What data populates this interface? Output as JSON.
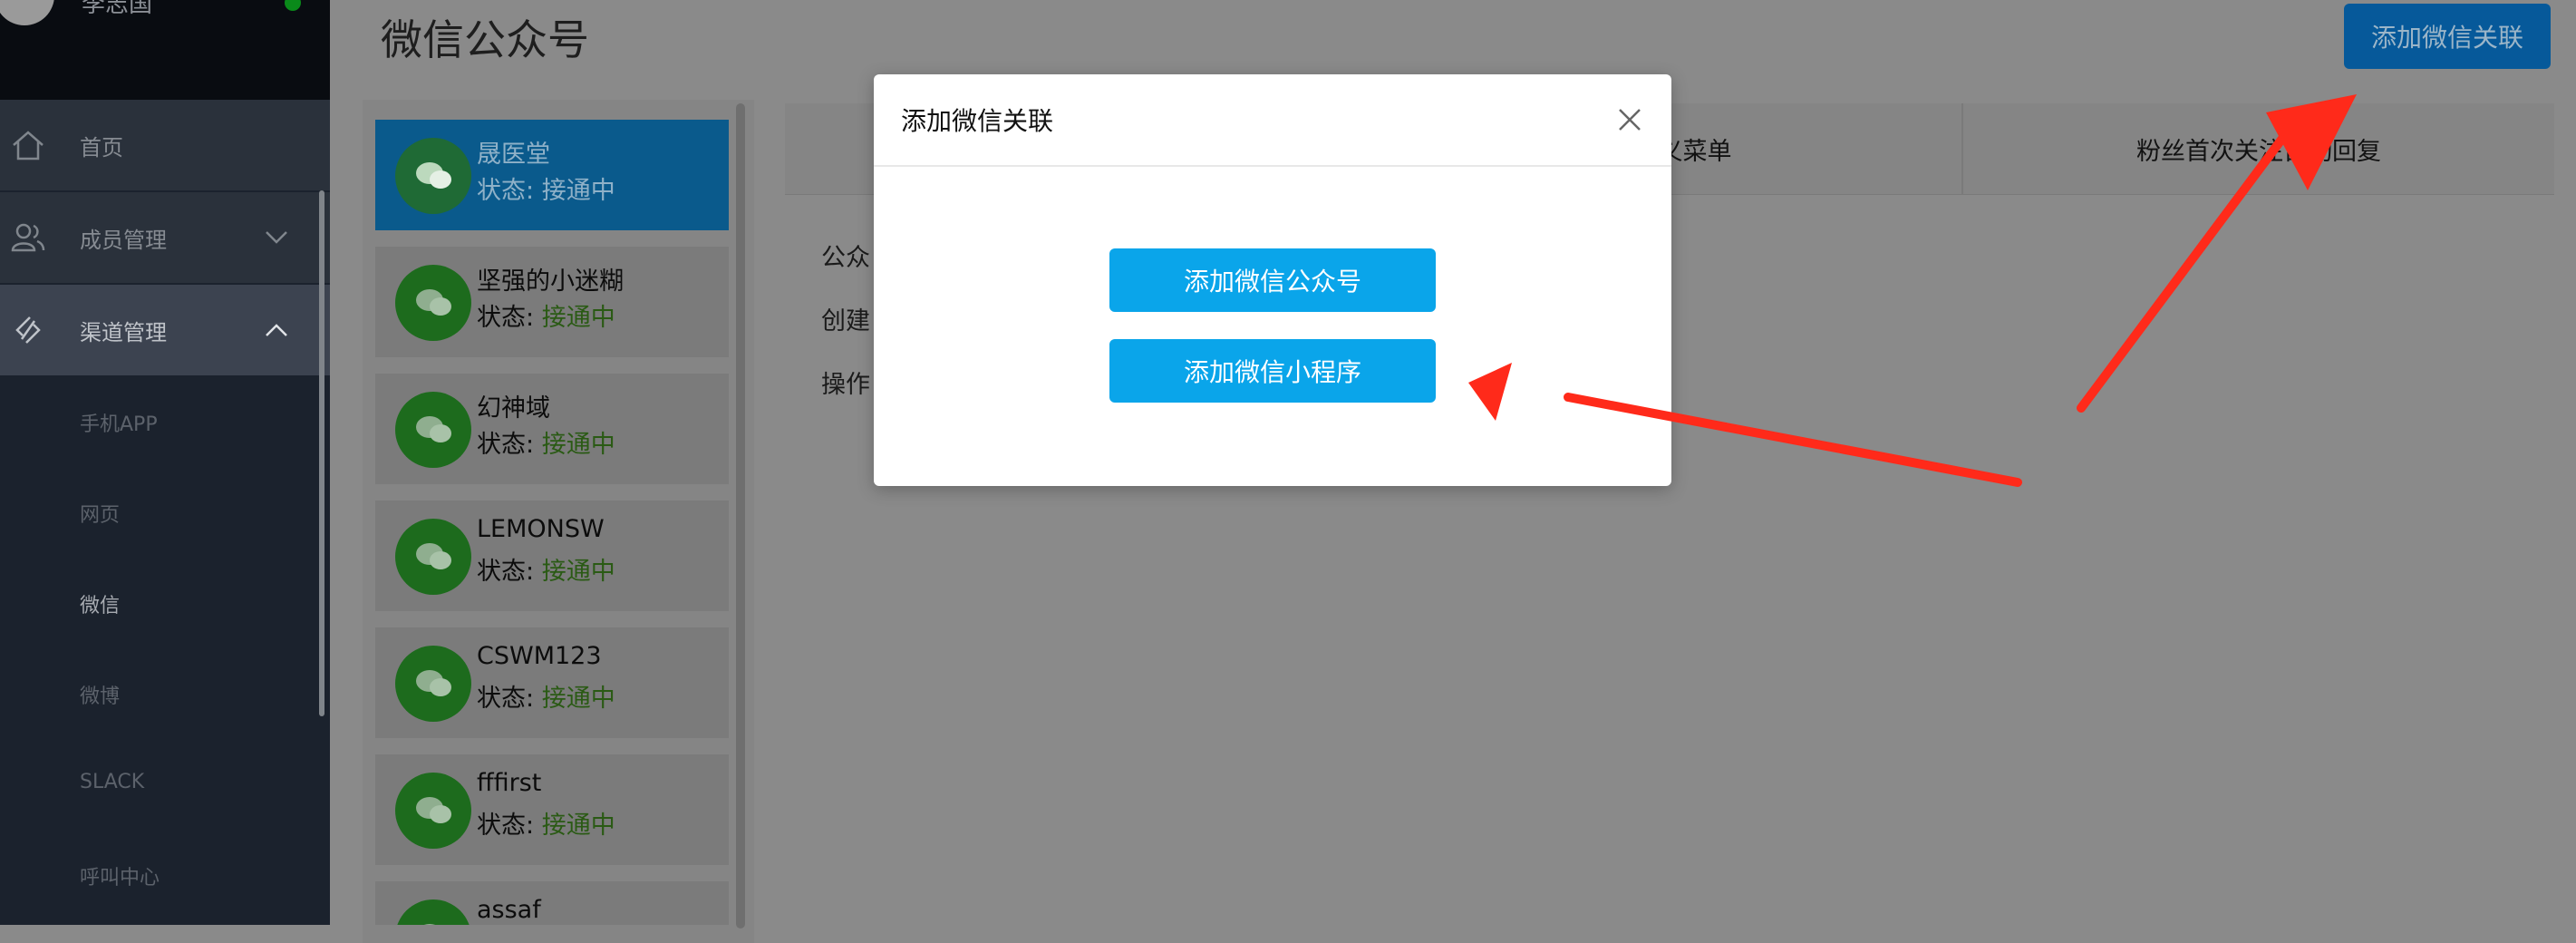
{
  "user": {
    "name": "李志国"
  },
  "sidebar": {
    "items": [
      {
        "label": "首页",
        "icon": "home-icon"
      },
      {
        "label": "成员管理",
        "icon": "users-icon"
      },
      {
        "label": "渠道管理",
        "icon": "channel-icon"
      }
    ],
    "sub_items": [
      "手机APP",
      "网页",
      "微信",
      "微博",
      "SLACK",
      "呼叫中心"
    ]
  },
  "header": {
    "title": "微信公众号",
    "add_button": "添加微信关联"
  },
  "accounts": [
    {
      "name": "晟医堂",
      "status_label": "状态:",
      "status_value": "接通中"
    },
    {
      "name": "坚强的小迷糊",
      "status_label": "状态:",
      "status_value": "接通中"
    },
    {
      "name": "幻神域",
      "status_label": "状态:",
      "status_value": "接通中"
    },
    {
      "name": "LEMONSW",
      "status_label": "状态:",
      "status_value": "接通中"
    },
    {
      "name": "CSWM123",
      "status_label": "状态:",
      "status_value": "接通中"
    },
    {
      "name": "fffirst",
      "status_label": "状态:",
      "status_value": "接通中"
    },
    {
      "name": "assaf",
      "status_label": "",
      "status_value": ""
    }
  ],
  "tabs": {
    "tab2_partial": "义菜单",
    "tab3": "粉丝首次关注自动回复",
    "tab3_obscured": "粉丝首次关注自"
  },
  "detail": {
    "labels": [
      "公众",
      "创建",
      "操作"
    ]
  },
  "modal": {
    "title": "添加微信关联",
    "btn_official": "添加微信公众号",
    "btn_mini": "添加微信小程序"
  },
  "colors": {
    "primary": "#0aa5ea",
    "status_green": "#52c41a",
    "annotation_arrow": "#ff2a1a",
    "sidebar_bg": "#1b222d"
  }
}
